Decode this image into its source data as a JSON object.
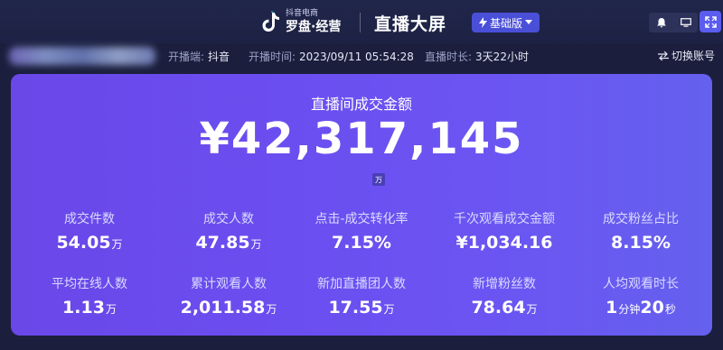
{
  "header": {
    "brand_sub": "抖音电商",
    "brand_main": "罗盘·经营",
    "title": "直播大屏",
    "version_label": "基础版"
  },
  "info": {
    "platform_label": "开播端:",
    "platform_value": "抖音",
    "start_label": "开播时间:",
    "start_value": "2023/09/11 05:54:28",
    "duration_label": "直播时长:",
    "duration_value": "3天22小时",
    "switch_label": "切换账号"
  },
  "card": {
    "title": "直播间成交金额",
    "amount": "¥42,317,145",
    "amount_unit": "万"
  },
  "metrics": [
    {
      "label": "成交件数",
      "value": "54.05",
      "unit": "万"
    },
    {
      "label": "成交人数",
      "value": "47.85",
      "unit": "万"
    },
    {
      "label": "点击-成交转化率",
      "value": "7.15%",
      "unit": ""
    },
    {
      "label": "千次观看成交金额",
      "value": "¥1,034.16",
      "unit": ""
    },
    {
      "label": "成交粉丝占比",
      "value": "8.15%",
      "unit": ""
    },
    {
      "label": "平均在线人数",
      "value": "1.13",
      "unit": "万"
    },
    {
      "label": "累计观看人数",
      "value": "2,011.58",
      "unit": "万"
    },
    {
      "label": "新加直播团人数",
      "value": "17.55",
      "unit": "万"
    },
    {
      "label": "新增粉丝数",
      "value": "78.64",
      "unit": "万"
    },
    {
      "label": "人均观看时长",
      "value_parts": [
        "1",
        "分钟",
        "20",
        "秒"
      ]
    }
  ],
  "colors": {
    "background": "#1b1f3d",
    "card_start": "#6a47e8",
    "card_end": "#6560ee",
    "accent": "#5b5cf0"
  }
}
